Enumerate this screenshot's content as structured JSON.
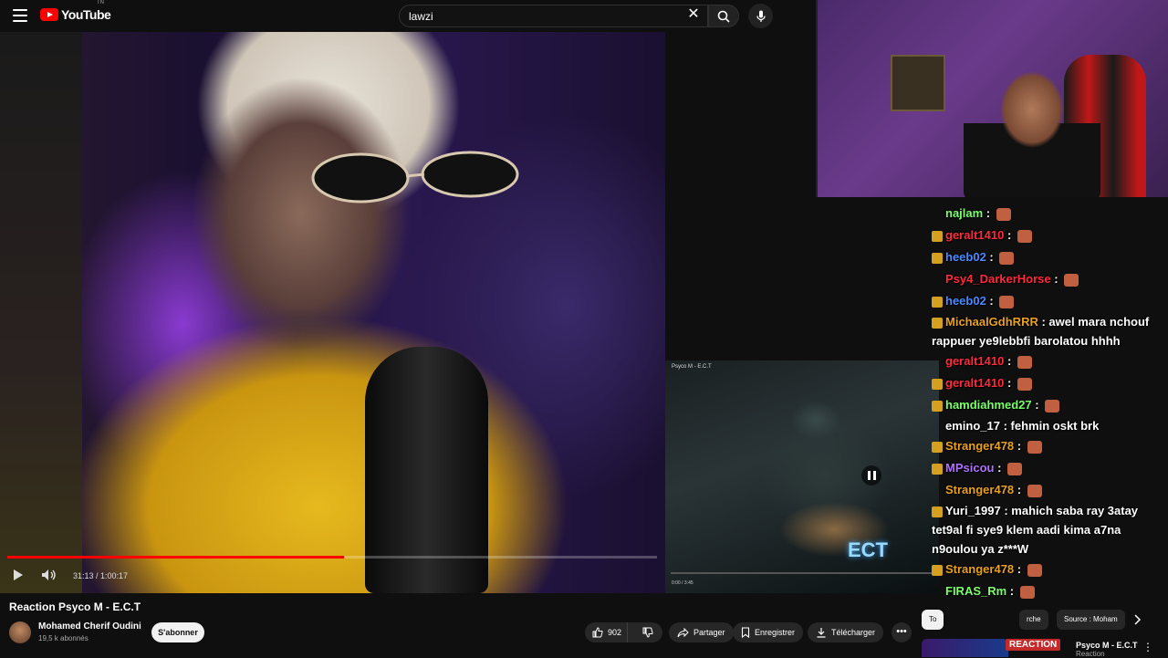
{
  "brand": {
    "name": "YouTube",
    "country_code": "TN"
  },
  "search": {
    "value": "lawzi",
    "clear_icon": "close-icon",
    "search_icon": "search-icon",
    "voice_icon": "microphone-icon"
  },
  "player": {
    "current_time": "31:13",
    "duration": "1:00:17",
    "time_display": "31:13 / 1:00:17",
    "progress_fraction": 0.518,
    "accent": "#ff0000"
  },
  "mini_video": {
    "title": "Psyco M - E.C.T",
    "overlay_text": "ECT",
    "time_display": "0:00 / 3:45"
  },
  "chat": {
    "messages": [
      {
        "user": "najlam",
        "color": "#7cff6b",
        "text": ""
      },
      {
        "user": "geralt1410",
        "color": "#ff2a3a",
        "text": ""
      },
      {
        "user": "heeb02",
        "color": "#4a8aff",
        "text": ""
      },
      {
        "user": "Psy4_DarkerHorse",
        "color": "#ff2a3a",
        "text": ""
      },
      {
        "user": "heeb02",
        "color": "#4a8aff",
        "text": ""
      },
      {
        "user": "MichaalGdhRRR",
        "color": "#e8a020",
        "text": "awel mara nchouf rappuer ye9lebbfi barolatou hhhh"
      },
      {
        "user": "geralt1410",
        "color": "#ff2a3a",
        "text": ""
      },
      {
        "user": "geralt1410",
        "color": "#ff2a3a",
        "text": ""
      },
      {
        "user": "hamdiahmed27",
        "color": "#7cff6b",
        "text": ""
      },
      {
        "user": "emino_17",
        "color": "#ffffff",
        "text": "fehmin oskt brk"
      },
      {
        "user": "Stranger478",
        "color": "#e8a020",
        "text": ""
      },
      {
        "user": "MPsicou",
        "color": "#b070ff",
        "text": ""
      },
      {
        "user": "Stranger478",
        "color": "#e8a020",
        "text": ""
      },
      {
        "user": "Yuri_1997",
        "color": "#ffffff",
        "text": "mahich saba ray 3atay tet9al fi sye9 klem aadi kima a7na n9oulou ya z***W"
      },
      {
        "user": "Stranger478",
        "color": "#e8a020",
        "text": ""
      },
      {
        "user": "FIRAS_Rm",
        "color": "#7cff6b",
        "text": ""
      }
    ]
  },
  "video": {
    "title": "Reaction Psyco M - E.C.T",
    "channel": "Mohamed Cherif Oudini",
    "subscribers": "19,5 k abonnés",
    "subscribe_label": "S'abonner",
    "likes": "902",
    "share_label": "Partager",
    "save_label": "Enregistrer",
    "download_label": "Télécharger"
  },
  "chips": [
    {
      "label": "To",
      "active": true
    },
    {
      "label": "rche",
      "active": false
    },
    {
      "label": "Source : Moham",
      "active": false
    }
  ],
  "recommended": {
    "badge": "REACTION",
    "title": "Psyco M - E.C.T",
    "subtitle": "Reaction"
  }
}
